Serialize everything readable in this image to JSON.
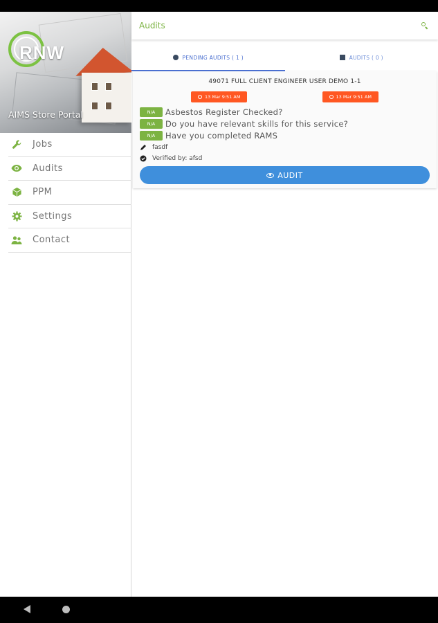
{
  "sidebar": {
    "logo_text": "RNW",
    "portal_title": "AIMS Store Portal",
    "items": [
      {
        "label": "Jobs",
        "icon": "wrench-icon"
      },
      {
        "label": "Audits",
        "icon": "eye-icon"
      },
      {
        "label": "PPM",
        "icon": "cube-icon"
      },
      {
        "label": "Settings",
        "icon": "gear-icon"
      },
      {
        "label": "Contact",
        "icon": "contact-icon"
      }
    ]
  },
  "header": {
    "title": "Audits"
  },
  "tabs": [
    {
      "label": "PENDING AUDITS ( 1 )",
      "active": true
    },
    {
      "label": "AUDITS ( 0 )",
      "active": false
    }
  ],
  "card": {
    "title": "49071 FULL CLIENT ENGINEER USER DEMO 1-1",
    "dates": [
      "13 Mar 9:51 AM",
      "13 Mar 9:51 AM"
    ],
    "questions": [
      {
        "badge": "N/A",
        "text": "Asbestos Register Checked?"
      },
      {
        "badge": "N/A",
        "text": "Do you have relevant skills for this service?"
      },
      {
        "badge": "N/A",
        "text": "Have you completed RAMS"
      }
    ],
    "signature": "fasdf",
    "verified": "Verified by: afsd",
    "action_label": "AUDIT"
  },
  "colors": {
    "accent_green": "#7cb342",
    "date_orange": "#ff5722",
    "button_blue": "#3f8fdc",
    "tab_blue": "#4a6fd0"
  }
}
